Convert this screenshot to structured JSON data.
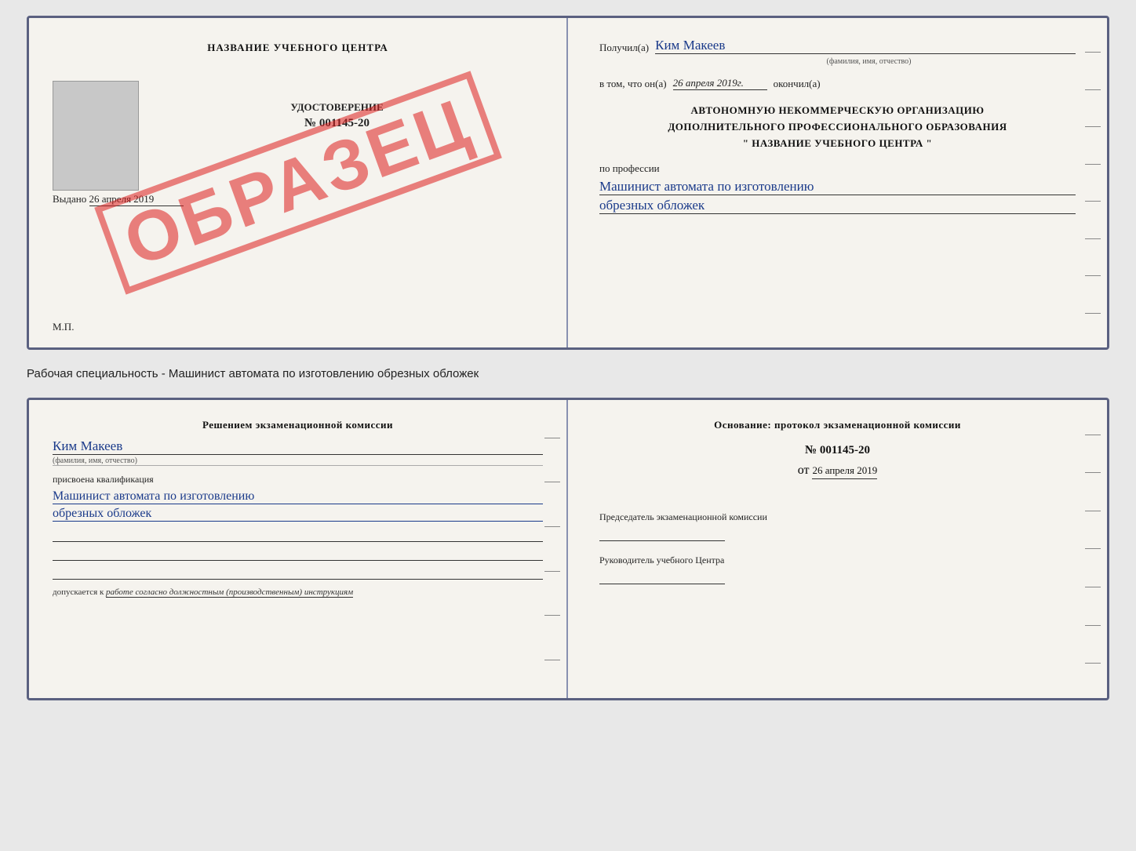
{
  "doc1": {
    "left": {
      "title": "НАЗВАНИЕ УЧЕБНОГО ЦЕНТРА",
      "stamp": "ОБРАЗЕЦ",
      "cert_label": "УДОСТОВЕРЕНИЕ",
      "cert_number": "№ 001145-20",
      "issued_prefix": "Выдано",
      "issued_date": "26 апреля 2019",
      "mp_label": "М.П."
    },
    "right": {
      "recipient_prefix": "Получил(а)",
      "recipient_name": "Ким Макеев",
      "fio_hint": "(фамилия, имя, отчество)",
      "date_prefix": "в том, что он(а)",
      "date_value": "26 апреля 2019г.",
      "date_suffix": "окончил(а)",
      "org_line1": "АВТОНОМНУЮ НЕКОММЕРЧЕСКУЮ ОРГАНИЗАЦИЮ",
      "org_line2": "ДОПОЛНИТЕЛЬНОГО ПРОФЕССИОНАЛЬНОГО ОБРАЗОВАНИЯ",
      "org_name": "\"  НАЗВАНИЕ УЧЕБНОГО ЦЕНТРА  \"",
      "profession_prefix": "по профессии",
      "profession_line1": "Машинист автомата по изготовлению",
      "profession_line2": "обрезных обложек"
    }
  },
  "caption": "Рабочая специальность - Машинист автомата по изготовлению обрезных обложек",
  "doc2": {
    "left": {
      "commission_text": "Решением экзаменационной комиссии",
      "person_name": "Ким Макеев",
      "fio_hint": "(фамилия, имя, отчество)",
      "qualification_label": "присвоена квалификация",
      "qualification_line1": "Машинист автомата по изготовлению",
      "qualification_line2": "обрезных обложек",
      "допускается_prefix": "допускается к",
      "допускается_italic": "работе согласно должностным (производственным) инструкциям"
    },
    "right": {
      "osnование": "Основание: протокол экзаменационной комиссии",
      "protocol_number": "№ 001145-20",
      "date_prefix": "от",
      "date_value": "26 апреля 2019",
      "chairman_label": "Председатель экзаменационной комиссии",
      "director_label": "Руководитель учебного Центра"
    }
  }
}
